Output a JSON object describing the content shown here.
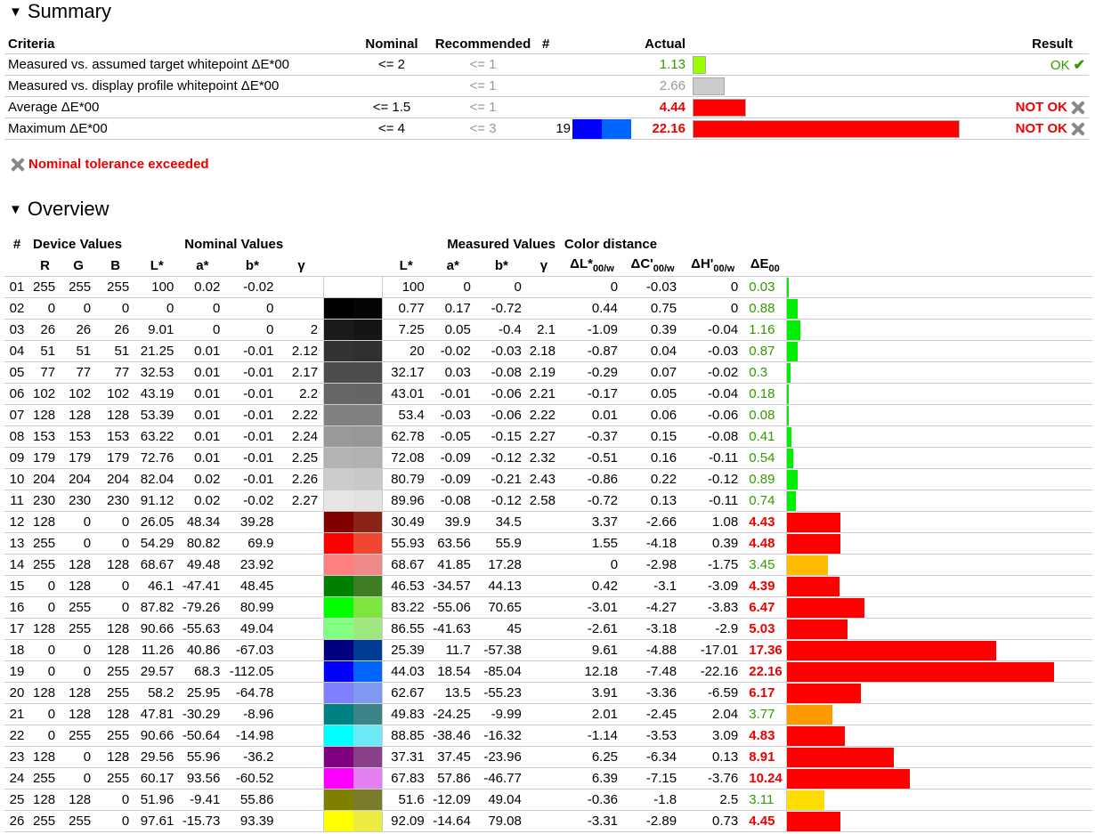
{
  "summary": {
    "title": "Summary",
    "headers": {
      "criteria": "Criteria",
      "nominal": "Nominal",
      "recommended": "Recommended",
      "count": "#",
      "actual": "Actual",
      "result": "Result"
    },
    "rows": [
      {
        "criteria": "Measured vs. assumed target whitepoint ΔE*00",
        "nominal": "<= 2",
        "recommended": "<= 1",
        "count": "",
        "actual": "1.13",
        "actual_class": "green",
        "bar_value": 1.13,
        "bar_color": "#99ff00",
        "result": "OK",
        "result_class": "green",
        "result_icon": "check-icon"
      },
      {
        "criteria": "Measured vs. display profile whitepoint ΔE*00",
        "nominal": "",
        "recommended": "<= 1",
        "count": "",
        "actual": "2.66",
        "actual_class": "grey",
        "bar_value": 2.66,
        "bar_color": "#cccccc",
        "result": "",
        "result_class": "",
        "result_icon": ""
      },
      {
        "criteria": "Average ΔE*00",
        "nominal": "<= 1.5",
        "recommended": "<= 1",
        "count": "",
        "actual": "4.44",
        "actual_class": "red",
        "bar_value": 4.44,
        "bar_color": "#ff0000",
        "result": "NOT OK",
        "result_class": "red",
        "result_icon": "x-icon"
      },
      {
        "criteria": "Maximum ΔE*00",
        "nominal": "<= 4",
        "recommended": "<= 3",
        "count": "19",
        "swatch_nominal": "#0000ff",
        "swatch_measured": "#0066ff",
        "actual": "22.16",
        "actual_class": "red",
        "bar_value": 22.16,
        "bar_color": "#ff0000",
        "result": "NOT OK",
        "result_class": "red",
        "result_icon": "x-icon"
      }
    ],
    "bar_max": 22.16,
    "warning": "Nominal tolerance exceeded"
  },
  "overview": {
    "title": "Overview",
    "group_headers": {
      "num": "#",
      "device": "Device Values",
      "nominal": "Nominal Values",
      "measured": "Measured Values",
      "distance": "Color distance"
    },
    "col_headers": {
      "R": "R",
      "G": "G",
      "B": "B",
      "L": "L*",
      "a": "a*",
      "b": "b*",
      "gamma": "γ",
      "mL": "L*",
      "ma": "a*",
      "mb": "b*",
      "mgamma": "γ",
      "dL": "ΔL*",
      "dC": "ΔC'",
      "dH": "ΔH'",
      "dE": "ΔE",
      "sub_w": "00/w",
      "sub_00": "00"
    },
    "bar_max": 22.16,
    "rows": [
      {
        "n": "01",
        "R": "255",
        "G": "255",
        "B": "255",
        "L": "100",
        "a": "0.02",
        "b": "-0.02",
        "g": "",
        "mL": "100",
        "ma": "0",
        "mb": "0",
        "mg": "",
        "dL": "0",
        "dC": "-0.03",
        "dH": "0",
        "dE": "0.03",
        "de_class": "green",
        "sw1": "#ffffff",
        "sw2": "#ffffff",
        "bar": 0.03,
        "bar_color": "#00ee00"
      },
      {
        "n": "02",
        "R": "0",
        "G": "0",
        "B": "0",
        "L": "0",
        "a": "0",
        "b": "0",
        "g": "",
        "mL": "0.77",
        "ma": "0.17",
        "mb": "-0.72",
        "mg": "",
        "dL": "0.44",
        "dC": "0.75",
        "dH": "0",
        "dE": "0.88",
        "de_class": "green",
        "sw1": "#000000",
        "sw2": "#050505",
        "bar": 0.88,
        "bar_color": "#00ee00"
      },
      {
        "n": "03",
        "R": "26",
        "G": "26",
        "B": "26",
        "L": "9.01",
        "a": "0",
        "b": "0",
        "g": "2",
        "mL": "7.25",
        "ma": "0.05",
        "mb": "-0.4",
        "mg": "2.1",
        "dL": "-1.09",
        "dC": "0.39",
        "dH": "-0.04",
        "dE": "1.16",
        "de_class": "green",
        "sw1": "#1a1a1a",
        "sw2": "#151515",
        "bar": 1.16,
        "bar_color": "#00ee00"
      },
      {
        "n": "04",
        "R": "51",
        "G": "51",
        "B": "51",
        "L": "21.25",
        "a": "0.01",
        "b": "-0.01",
        "g": "2.12",
        "mL": "20",
        "ma": "-0.02",
        "mb": "-0.03",
        "mg": "2.18",
        "dL": "-0.87",
        "dC": "0.04",
        "dH": "-0.03",
        "dE": "0.87",
        "de_class": "green",
        "sw1": "#333333",
        "sw2": "#303030",
        "bar": 0.87,
        "bar_color": "#00ee00"
      },
      {
        "n": "05",
        "R": "77",
        "G": "77",
        "B": "77",
        "L": "32.53",
        "a": "0.01",
        "b": "-0.01",
        "g": "2.17",
        "mL": "32.17",
        "ma": "0.03",
        "mb": "-0.08",
        "mg": "2.19",
        "dL": "-0.29",
        "dC": "0.07",
        "dH": "-0.02",
        "dE": "0.3",
        "de_class": "green",
        "sw1": "#4d4d4d",
        "sw2": "#4c4c4c",
        "bar": 0.3,
        "bar_color": "#00ee00"
      },
      {
        "n": "06",
        "R": "102",
        "G": "102",
        "B": "102",
        "L": "43.19",
        "a": "0.01",
        "b": "-0.01",
        "g": "2.2",
        "mL": "43.01",
        "ma": "-0.01",
        "mb": "-0.06",
        "mg": "2.21",
        "dL": "-0.17",
        "dC": "0.05",
        "dH": "-0.04",
        "dE": "0.18",
        "de_class": "green",
        "sw1": "#666666",
        "sw2": "#656565",
        "bar": 0.18,
        "bar_color": "#00ee00"
      },
      {
        "n": "07",
        "R": "128",
        "G": "128",
        "B": "128",
        "L": "53.39",
        "a": "0.01",
        "b": "-0.01",
        "g": "2.22",
        "mL": "53.4",
        "ma": "-0.03",
        "mb": "-0.06",
        "mg": "2.22",
        "dL": "0.01",
        "dC": "0.06",
        "dH": "-0.06",
        "dE": "0.08",
        "de_class": "green",
        "sw1": "#808080",
        "sw2": "#808080",
        "bar": 0.08,
        "bar_color": "#00ee00"
      },
      {
        "n": "08",
        "R": "153",
        "G": "153",
        "B": "153",
        "L": "63.22",
        "a": "0.01",
        "b": "-0.01",
        "g": "2.24",
        "mL": "62.78",
        "ma": "-0.05",
        "mb": "-0.15",
        "mg": "2.27",
        "dL": "-0.37",
        "dC": "0.15",
        "dH": "-0.08",
        "dE": "0.41",
        "de_class": "green",
        "sw1": "#999999",
        "sw2": "#979797",
        "bar": 0.41,
        "bar_color": "#00ee00"
      },
      {
        "n": "09",
        "R": "179",
        "G": "179",
        "B": "179",
        "L": "72.76",
        "a": "0.01",
        "b": "-0.01",
        "g": "2.25",
        "mL": "72.08",
        "ma": "-0.09",
        "mb": "-0.12",
        "mg": "2.32",
        "dL": "-0.51",
        "dC": "0.16",
        "dH": "-0.11",
        "dE": "0.54",
        "de_class": "green",
        "sw1": "#b3b3b3",
        "sw2": "#b1b1b1",
        "bar": 0.54,
        "bar_color": "#00ee00"
      },
      {
        "n": "10",
        "R": "204",
        "G": "204",
        "B": "204",
        "L": "82.04",
        "a": "0.02",
        "b": "-0.01",
        "g": "2.26",
        "mL": "80.79",
        "ma": "-0.09",
        "mb": "-0.21",
        "mg": "2.43",
        "dL": "-0.86",
        "dC": "0.22",
        "dH": "-0.12",
        "dE": "0.89",
        "de_class": "green",
        "sw1": "#cccccc",
        "sw2": "#c8c8c8",
        "bar": 0.89,
        "bar_color": "#00ee00"
      },
      {
        "n": "11",
        "R": "230",
        "G": "230",
        "B": "230",
        "L": "91.12",
        "a": "0.02",
        "b": "-0.02",
        "g": "2.27",
        "mL": "89.96",
        "ma": "-0.08",
        "mb": "-0.12",
        "mg": "2.58",
        "dL": "-0.72",
        "dC": "0.13",
        "dH": "-0.11",
        "dE": "0.74",
        "de_class": "green",
        "sw1": "#e6e6e6",
        "sw2": "#e2e2e2",
        "bar": 0.74,
        "bar_color": "#00ee00"
      },
      {
        "n": "12",
        "R": "128",
        "G": "0",
        "B": "0",
        "L": "26.05",
        "a": "48.34",
        "b": "39.28",
        "g": "",
        "mL": "30.49",
        "ma": "39.9",
        "mb": "34.5",
        "mg": "",
        "dL": "3.37",
        "dC": "-2.66",
        "dH": "1.08",
        "dE": "4.43",
        "de_class": "red",
        "sw1": "#800000",
        "sw2": "#8b2316",
        "bar": 4.43,
        "bar_color": "#ff0000"
      },
      {
        "n": "13",
        "R": "255",
        "G": "0",
        "B": "0",
        "L": "54.29",
        "a": "80.82",
        "b": "69.9",
        "g": "",
        "mL": "55.93",
        "ma": "63.56",
        "mb": "55.9",
        "mg": "",
        "dL": "1.55",
        "dC": "-4.18",
        "dH": "0.39",
        "dE": "4.48",
        "de_class": "red",
        "sw1": "#ff0000",
        "sw2": "#ee4630",
        "bar": 4.48,
        "bar_color": "#ff0000"
      },
      {
        "n": "14",
        "R": "255",
        "G": "128",
        "B": "128",
        "L": "68.67",
        "a": "49.48",
        "b": "23.92",
        "g": "",
        "mL": "68.67",
        "ma": "41.85",
        "mb": "17.28",
        "mg": "",
        "dL": "0",
        "dC": "-2.98",
        "dH": "-1.75",
        "dE": "3.45",
        "de_class": "green",
        "sw1": "#ff8080",
        "sw2": "#f08a8a",
        "bar": 3.45,
        "bar_color": "#ffbb00"
      },
      {
        "n": "15",
        "R": "0",
        "G": "128",
        "B": "0",
        "L": "46.1",
        "a": "-47.41",
        "b": "48.45",
        "g": "",
        "mL": "46.53",
        "ma": "-34.57",
        "mb": "44.13",
        "mg": "",
        "dL": "0.42",
        "dC": "-3.1",
        "dH": "-3.09",
        "dE": "4.39",
        "de_class": "red",
        "sw1": "#008000",
        "sw2": "#3d7d24",
        "bar": 4.39,
        "bar_color": "#ff0000"
      },
      {
        "n": "16",
        "R": "0",
        "G": "255",
        "B": "0",
        "L": "87.82",
        "a": "-79.26",
        "b": "80.99",
        "g": "",
        "mL": "83.22",
        "ma": "-55.06",
        "mb": "70.65",
        "mg": "",
        "dL": "-3.01",
        "dC": "-4.27",
        "dH": "-3.83",
        "dE": "6.47",
        "de_class": "red",
        "sw1": "#00ff00",
        "sw2": "#7ee53e",
        "bar": 6.47,
        "bar_color": "#ff0000"
      },
      {
        "n": "17",
        "R": "128",
        "G": "255",
        "B": "128",
        "L": "90.66",
        "a": "-55.63",
        "b": "49.04",
        "g": "",
        "mL": "86.55",
        "ma": "-41.63",
        "mb": "45",
        "mg": "",
        "dL": "-2.61",
        "dC": "-3.18",
        "dH": "-2.9",
        "dE": "5.03",
        "de_class": "red",
        "sw1": "#80ff80",
        "sw2": "#9ee87e",
        "bar": 5.03,
        "bar_color": "#ff0000"
      },
      {
        "n": "18",
        "R": "0",
        "G": "0",
        "B": "128",
        "L": "11.26",
        "a": "40.86",
        "b": "-67.03",
        "g": "",
        "mL": "25.39",
        "ma": "11.7",
        "mb": "-57.38",
        "mg": "",
        "dL": "9.61",
        "dC": "-4.88",
        "dH": "-17.01",
        "dE": "17.36",
        "de_class": "red",
        "sw1": "#000080",
        "sw2": "#003b94",
        "bar": 17.36,
        "bar_color": "#ff0000"
      },
      {
        "n": "19",
        "R": "0",
        "G": "0",
        "B": "255",
        "L": "29.57",
        "a": "68.3",
        "b": "-112.05",
        "g": "",
        "mL": "44.03",
        "ma": "18.54",
        "mb": "-85.04",
        "mg": "",
        "dL": "12.18",
        "dC": "-7.48",
        "dH": "-22.16",
        "dE": "22.16",
        "de_class": "red",
        "sw1": "#0000ff",
        "sw2": "#0066ff",
        "bar": 22.16,
        "bar_color": "#ff0000"
      },
      {
        "n": "20",
        "R": "128",
        "G": "128",
        "B": "255",
        "L": "58.2",
        "a": "25.95",
        "b": "-64.78",
        "g": "",
        "mL": "62.67",
        "ma": "13.5",
        "mb": "-55.23",
        "mg": "",
        "dL": "3.91",
        "dC": "-3.36",
        "dH": "-6.59",
        "dE": "6.17",
        "de_class": "red",
        "sw1": "#8080ff",
        "sw2": "#7f99f2",
        "bar": 6.17,
        "bar_color": "#ff0000"
      },
      {
        "n": "21",
        "R": "0",
        "G": "128",
        "B": "128",
        "L": "47.81",
        "a": "-30.29",
        "b": "-8.96",
        "g": "",
        "mL": "49.83",
        "ma": "-24.25",
        "mb": "-9.99",
        "mg": "",
        "dL": "2.01",
        "dC": "-2.45",
        "dH": "2.04",
        "dE": "3.77",
        "de_class": "green",
        "sw1": "#008080",
        "sw2": "#3b8488",
        "bar": 3.77,
        "bar_color": "#ff9900"
      },
      {
        "n": "22",
        "R": "0",
        "G": "255",
        "B": "255",
        "L": "90.66",
        "a": "-50.64",
        "b": "-14.98",
        "g": "",
        "mL": "88.85",
        "ma": "-38.46",
        "mb": "-16.32",
        "mg": "",
        "dL": "-1.14",
        "dC": "-3.53",
        "dH": "3.09",
        "dE": "4.83",
        "de_class": "red",
        "sw1": "#00ffff",
        "sw2": "#6ce9f4",
        "bar": 4.83,
        "bar_color": "#ff0000"
      },
      {
        "n": "23",
        "R": "128",
        "G": "0",
        "B": "128",
        "L": "29.56",
        "a": "55.96",
        "b": "-36.2",
        "g": "",
        "mL": "37.31",
        "ma": "37.45",
        "mb": "-23.96",
        "mg": "",
        "dL": "6.25",
        "dC": "-6.34",
        "dH": "0.13",
        "dE": "8.91",
        "de_class": "red",
        "sw1": "#800080",
        "sw2": "#88408a",
        "bar": 8.91,
        "bar_color": "#ff0000"
      },
      {
        "n": "24",
        "R": "255",
        "G": "0",
        "B": "255",
        "L": "60.17",
        "a": "93.56",
        "b": "-60.52",
        "g": "",
        "mL": "67.83",
        "ma": "57.86",
        "mb": "-46.77",
        "mg": "",
        "dL": "6.39",
        "dC": "-7.15",
        "dH": "-3.76",
        "dE": "10.24",
        "de_class": "red",
        "sw1": "#ff00ff",
        "sw2": "#e37ff0",
        "bar": 10.24,
        "bar_color": "#ff0000"
      },
      {
        "n": "25",
        "R": "128",
        "G": "128",
        "B": "0",
        "L": "51.96",
        "a": "-9.41",
        "b": "55.86",
        "g": "",
        "mL": "51.6",
        "ma": "-12.09",
        "mb": "49.04",
        "mg": "",
        "dL": "-0.36",
        "dC": "-1.8",
        "dH": "2.5",
        "dE": "3.11",
        "de_class": "green",
        "sw1": "#808000",
        "sw2": "#7a7c2c",
        "bar": 3.11,
        "bar_color": "#ffdd00"
      },
      {
        "n": "26",
        "R": "255",
        "G": "255",
        "B": "0",
        "L": "97.61",
        "a": "-15.73",
        "b": "93.39",
        "g": "",
        "mL": "92.09",
        "ma": "-14.64",
        "mb": "79.08",
        "mg": "",
        "dL": "-3.31",
        "dC": "-2.89",
        "dH": "0.73",
        "dE": "4.45",
        "de_class": "red",
        "sw1": "#ffff00",
        "sw2": "#ecec40",
        "bar": 4.45,
        "bar_color": "#ff0000"
      }
    ]
  }
}
